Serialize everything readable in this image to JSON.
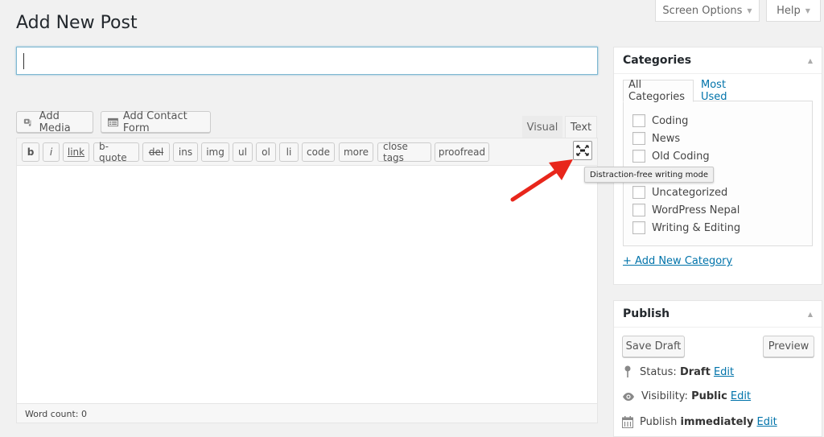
{
  "top_tabs": {
    "screen_options": "Screen Options",
    "help": "Help"
  },
  "page": {
    "title": "Add New Post"
  },
  "title_input": {
    "value": "",
    "placeholder": ""
  },
  "editor": {
    "media_buttons": [
      {
        "label": "Add Media",
        "icon": "media-icon"
      },
      {
        "label": "Add Contact Form",
        "icon": "form-icon"
      }
    ],
    "mode_tabs": [
      {
        "label": "Visual",
        "active": false
      },
      {
        "label": "Text",
        "active": true
      }
    ],
    "quicktags": [
      "b",
      "i",
      "link",
      "b-quote",
      "del",
      "ins",
      "img",
      "ul",
      "ol",
      "li",
      "code",
      "more",
      "close tags",
      "proofread"
    ],
    "dfw_tooltip": "Distraction-free writing mode",
    "word_count": "Word count: 0",
    "content": ""
  },
  "categories": {
    "title": "Categories",
    "tabs": [
      {
        "label": "All Categories",
        "active": true
      },
      {
        "label": "Most Used",
        "active": false
      }
    ],
    "items": [
      {
        "label": "Coding",
        "checked": false
      },
      {
        "label": "News",
        "checked": false
      },
      {
        "label": "Old Coding",
        "checked": false
      },
      {
        "label": "",
        "checked": false
      },
      {
        "label": "Uncategorized",
        "checked": false
      },
      {
        "label": "WordPress Nepal",
        "checked": false
      },
      {
        "label": "Writing & Editing",
        "checked": false
      }
    ],
    "add_new": "+ Add New Category"
  },
  "publish": {
    "title": "Publish",
    "save_draft": "Save Draft",
    "preview": "Preview",
    "status_label": "Status:",
    "status_value": "Draft",
    "visibility_label": "Visibility:",
    "visibility_value": "Public",
    "publish_label": "Publish",
    "publish_value": "immediately",
    "edit": "Edit"
  },
  "colors": {
    "link": "#0073aa",
    "annotation_arrow": "#e8261b",
    "focus_border": "#7fb8d2"
  }
}
